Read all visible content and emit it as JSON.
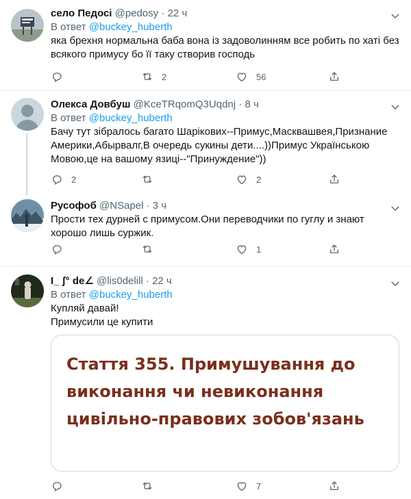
{
  "tweets": [
    {
      "name": "село Педосі",
      "handle": "@pedosy",
      "dot": "·",
      "time": "22 ч",
      "reply_prefix": "В ответ",
      "reply_to": "@buckey_huberth",
      "lines": [
        "яка брехня нормальна баба вона із задоволинням все робить по хаті без",
        "всякого примусу бо її таку створив господь"
      ],
      "replies": "",
      "retweets": "2",
      "likes": "56"
    },
    {
      "name": "Олекса Довбуш",
      "handle": "@KceTRqomQ3Uqdnj",
      "dot": "·",
      "time": "8 ч",
      "reply_prefix": "В ответ",
      "reply_to": "@buckey_huberth",
      "lines": [
        "Бачу тут зібралось багато Шарікових--Примус,Масквашвея,Признание",
        "Америки,Абырвалг,В очередь сукины дети....))Примус Українською",
        "Мовою,це на вашому язиці--\"Принуждение\"))"
      ],
      "replies": "2",
      "retweets": "",
      "likes": "2"
    },
    {
      "name": "Русофоб",
      "handle": "@NSapel",
      "dot": "·",
      "time": "3 ч",
      "lines": [
        "Прости тех дурней с примусом.Они переводчики по гуглу и знают",
        "хорошо лишь суржик."
      ],
      "replies": "",
      "retweets": "",
      "likes": "1"
    },
    {
      "name": "I_ ʃ° de∠",
      "handle": "@lis0delill",
      "dot": "·",
      "time": "22 ч",
      "reply_prefix": "В ответ",
      "reply_to": "@buckey_huberth",
      "lines": [
        "Купляй давай!",
        "Примусили це купити"
      ],
      "card_text": "Стаття 355. Примушування до виконання чи невиконання цивільно-правових зобов'язань",
      "replies": "",
      "retweets": "",
      "likes": "7"
    }
  ],
  "colors": {
    "link": "#1d9bf0",
    "secondary": "#536471",
    "border": "#e6ecf0",
    "card_text": "#7a2f1c"
  },
  "icons": [
    "more-icon",
    "reply-icon",
    "retweet-icon",
    "like-icon",
    "share-icon"
  ]
}
